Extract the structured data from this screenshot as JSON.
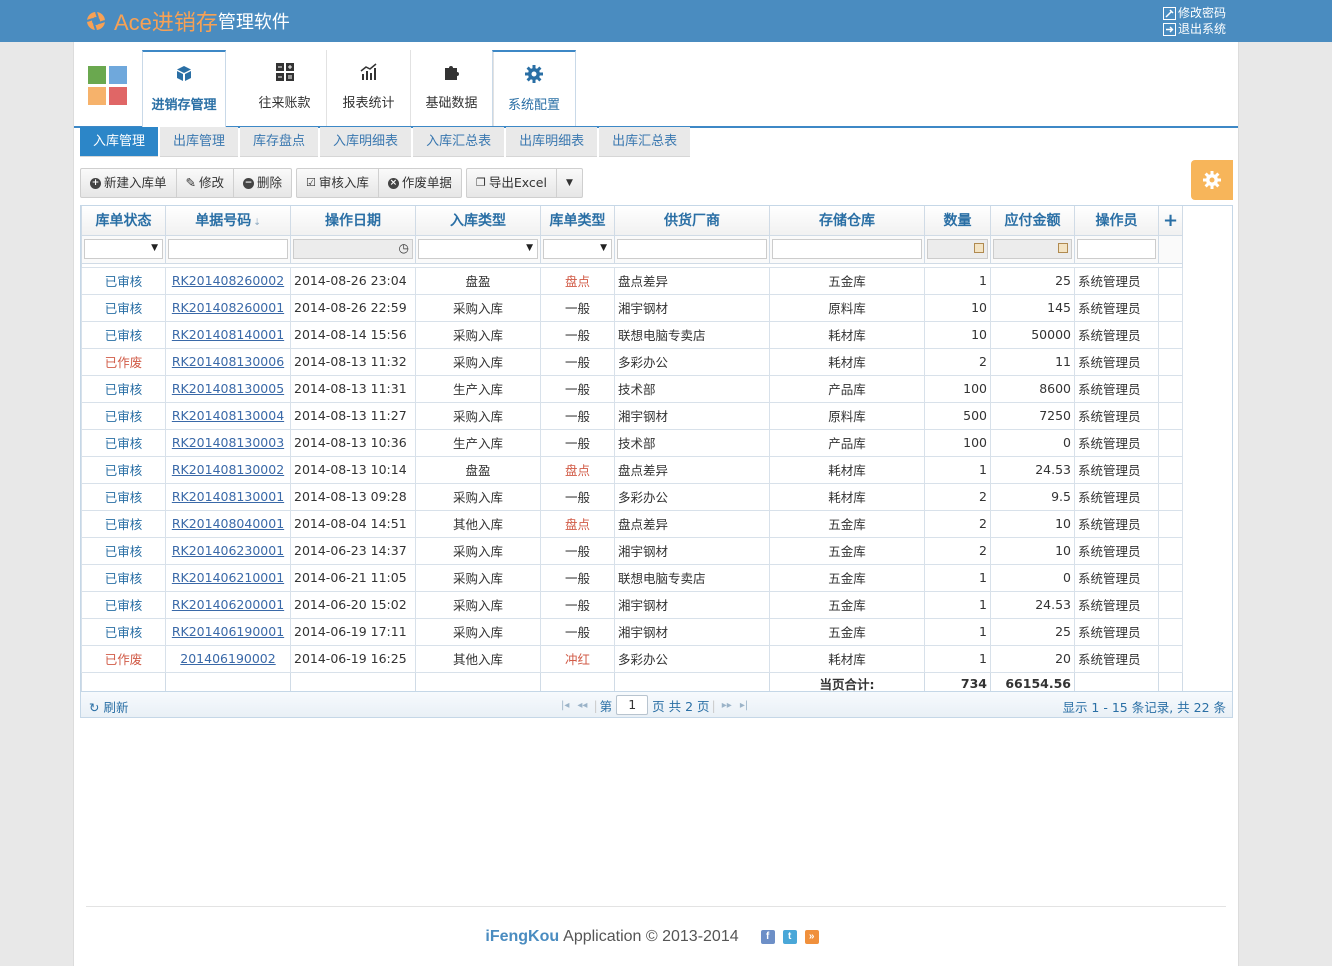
{
  "header": {
    "brand_main": "Ace进销存",
    "brand_sub": "管理软件",
    "change_password": "修改密码",
    "logout": "退出系统"
  },
  "ribbon_tabs": [
    {
      "label": "进销存管理",
      "icon": "cube-icon"
    },
    {
      "label": "往来账款",
      "icon": "calculator-icon"
    },
    {
      "label": "报表统计",
      "icon": "chart-icon"
    },
    {
      "label": "基础数据",
      "icon": "puzzle-icon"
    },
    {
      "label": "系统配置",
      "icon": "gear-icon"
    }
  ],
  "sub_tabs": [
    "入库管理",
    "出库管理",
    "库存盘点",
    "入库明细表",
    "入库汇总表",
    "出库明细表",
    "出库汇总表"
  ],
  "toolbar": {
    "new": "新建入库单",
    "edit": "修改",
    "delete": "删除",
    "approve": "审核入库",
    "void": "作废单据",
    "export": "导出Excel"
  },
  "columns": [
    "库单状态",
    "单据号码",
    "操作日期",
    "入库类型",
    "库单类型",
    "供货厂商",
    "存储仓库",
    "数量",
    "应付金额",
    "操作员"
  ],
  "add_column_symbol": "+",
  "rows": [
    {
      "status": "已审核",
      "no": "RK201408260002",
      "date": "2014-08-26 23:04",
      "in_type": "盘盈",
      "doc_type": "盘点",
      "supplier": "盘点差异",
      "warehouse": "五金库",
      "qty": "1",
      "amount": "25",
      "operator": "系统管理员"
    },
    {
      "status": "已审核",
      "no": "RK201408260001",
      "date": "2014-08-26 22:59",
      "in_type": "采购入库",
      "doc_type": "一般",
      "supplier": "湘宇钢材",
      "warehouse": "原料库",
      "qty": "10",
      "amount": "145",
      "operator": "系统管理员"
    },
    {
      "status": "已审核",
      "no": "RK201408140001",
      "date": "2014-08-14 15:56",
      "in_type": "采购入库",
      "doc_type": "一般",
      "supplier": "联想电脑专卖店",
      "warehouse": "耗材库",
      "qty": "10",
      "amount": "50000",
      "operator": "系统管理员"
    },
    {
      "status": "已作废",
      "no": "RK201408130006",
      "date": "2014-08-13 11:32",
      "in_type": "采购入库",
      "doc_type": "一般",
      "supplier": "多彩办公",
      "warehouse": "耗材库",
      "qty": "2",
      "amount": "11",
      "operator": "系统管理员"
    },
    {
      "status": "已审核",
      "no": "RK201408130005",
      "date": "2014-08-13 11:31",
      "in_type": "生产入库",
      "doc_type": "一般",
      "supplier": "技术部",
      "warehouse": "产品库",
      "qty": "100",
      "amount": "8600",
      "operator": "系统管理员"
    },
    {
      "status": "已审核",
      "no": "RK201408130004",
      "date": "2014-08-13 11:27",
      "in_type": "采购入库",
      "doc_type": "一般",
      "supplier": "湘宇钢材",
      "warehouse": "原料库",
      "qty": "500",
      "amount": "7250",
      "operator": "系统管理员"
    },
    {
      "status": "已审核",
      "no": "RK201408130003",
      "date": "2014-08-13 10:36",
      "in_type": "生产入库",
      "doc_type": "一般",
      "supplier": "技术部",
      "warehouse": "产品库",
      "qty": "100",
      "amount": "0",
      "operator": "系统管理员"
    },
    {
      "status": "已审核",
      "no": "RK201408130002",
      "date": "2014-08-13 10:14",
      "in_type": "盘盈",
      "doc_type": "盘点",
      "supplier": "盘点差异",
      "warehouse": "耗材库",
      "qty": "1",
      "amount": "24.53",
      "operator": "系统管理员"
    },
    {
      "status": "已审核",
      "no": "RK201408130001",
      "date": "2014-08-13 09:28",
      "in_type": "采购入库",
      "doc_type": "一般",
      "supplier": "多彩办公",
      "warehouse": "耗材库",
      "qty": "2",
      "amount": "9.5",
      "operator": "系统管理员"
    },
    {
      "status": "已审核",
      "no": "RK201408040001",
      "date": "2014-08-04 14:51",
      "in_type": "其他入库",
      "doc_type": "盘点",
      "supplier": "盘点差异",
      "warehouse": "五金库",
      "qty": "2",
      "amount": "10",
      "operator": "系统管理员"
    },
    {
      "status": "已审核",
      "no": "RK201406230001",
      "date": "2014-06-23 14:37",
      "in_type": "采购入库",
      "doc_type": "一般",
      "supplier": "湘宇钢材",
      "warehouse": "五金库",
      "qty": "2",
      "amount": "10",
      "operator": "系统管理员"
    },
    {
      "status": "已审核",
      "no": "RK201406210001",
      "date": "2014-06-21 11:05",
      "in_type": "采购入库",
      "doc_type": "一般",
      "supplier": "联想电脑专卖店",
      "warehouse": "五金库",
      "qty": "1",
      "amount": "0",
      "operator": "系统管理员"
    },
    {
      "status": "已审核",
      "no": "RK201406200001",
      "date": "2014-06-20 15:02",
      "in_type": "采购入库",
      "doc_type": "一般",
      "supplier": "湘宇钢材",
      "warehouse": "五金库",
      "qty": "1",
      "amount": "24.53",
      "operator": "系统管理员"
    },
    {
      "status": "已审核",
      "no": "RK201406190001",
      "date": "2014-06-19 17:11",
      "in_type": "采购入库",
      "doc_type": "一般",
      "supplier": "湘宇钢材",
      "warehouse": "五金库",
      "qty": "1",
      "amount": "25",
      "operator": "系统管理员"
    },
    {
      "status": "已作废",
      "no": "201406190002",
      "date": "2014-06-19 16:25",
      "in_type": "其他入库",
      "doc_type": "冲红",
      "supplier": "多彩办公",
      "warehouse": "耗材库",
      "qty": "1",
      "amount": "20",
      "operator": "系统管理员"
    }
  ],
  "totals": {
    "label": "当页合计:",
    "qty": "734",
    "amount": "66154.56"
  },
  "pager": {
    "refresh": "刷新",
    "page_prefix": "第",
    "page_value": "1",
    "page_suffix": "页 共 2 页",
    "info": "显示 1 - 15 条记录, 共 22 条"
  },
  "footer": {
    "brand": "iFengKou",
    "text": "Application © 2013-2014"
  },
  "colors": {
    "header_bg": "#4a8cc0",
    "accent": "#2c86c8",
    "status_ok": "#2a6fa5",
    "status_void": "#d15b47",
    "gear_button": "#f7b55a"
  }
}
